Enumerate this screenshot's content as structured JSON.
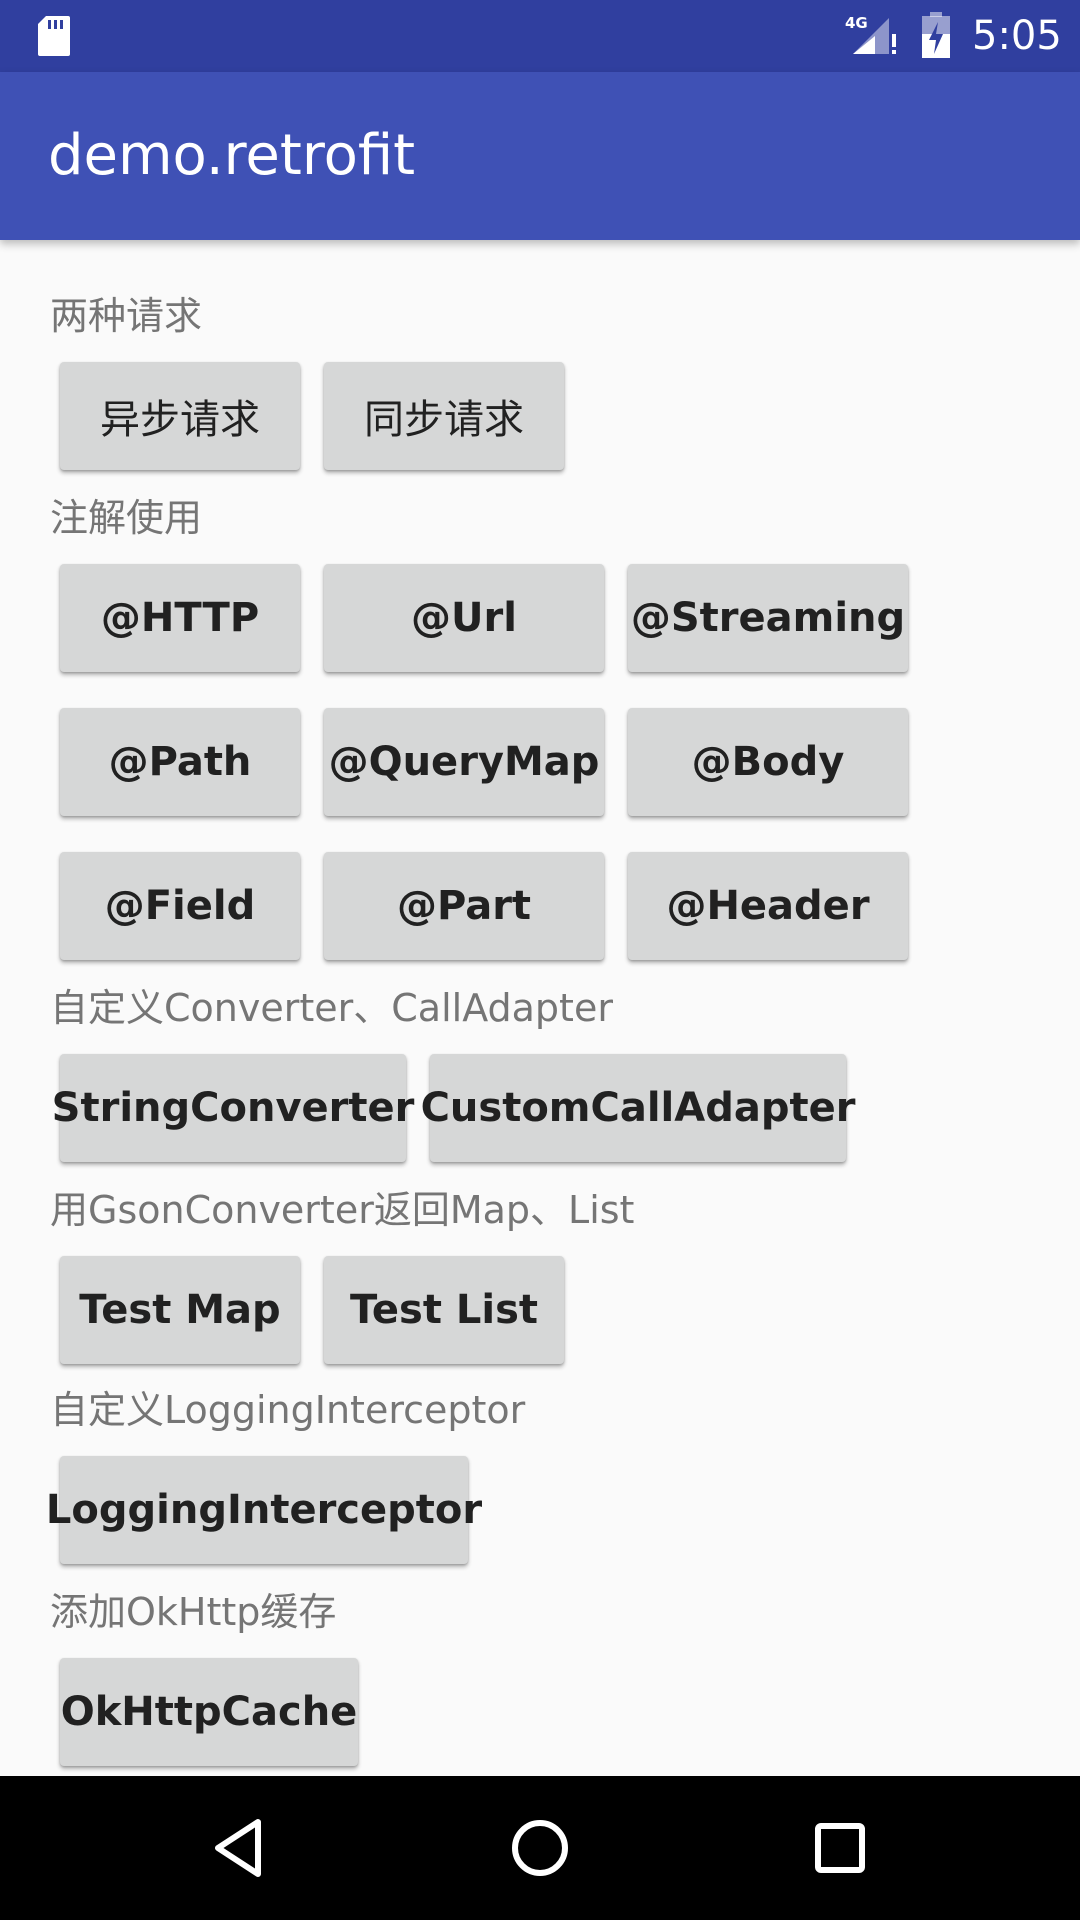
{
  "status_bar": {
    "time": "5:05",
    "network_label": "4G",
    "icons": [
      "sd-card-icon",
      "signal-4g-icon",
      "battery-charging-icon"
    ]
  },
  "app_bar": {
    "title": "demo.retrofit"
  },
  "sections": {
    "requests": {
      "label": "两种请求",
      "buttons": [
        "异步请求",
        "同步请求"
      ]
    },
    "annotations": {
      "label": "注解使用",
      "buttons": [
        "@HTTP",
        "@Url",
        "@Streaming",
        "@Path",
        "@QueryMap",
        "@Body",
        "@Field",
        "@Part",
        "@Header"
      ]
    },
    "converters": {
      "label": "自定义Converter、CallAdapter",
      "buttons": [
        "StringConverter",
        "CustomCallAdapter"
      ]
    },
    "gson": {
      "label": "用GsonConverter返回Map、List",
      "buttons": [
        "Test Map",
        "Test List"
      ]
    },
    "logging": {
      "label": "自定义LoggingInterceptor",
      "buttons": [
        "LoggingInterceptor"
      ]
    },
    "cache": {
      "label": "添加OkHttp缓存",
      "buttons": [
        "OkHttpCache"
      ]
    }
  },
  "nav_bar": {
    "icons": [
      "back-icon",
      "home-icon",
      "recents-icon"
    ]
  },
  "colors": {
    "status_bar": "#303f9f",
    "app_bar": "#3f51b5",
    "background": "#fafafa",
    "button": "#d6d7d7",
    "label_text": "#757575"
  }
}
